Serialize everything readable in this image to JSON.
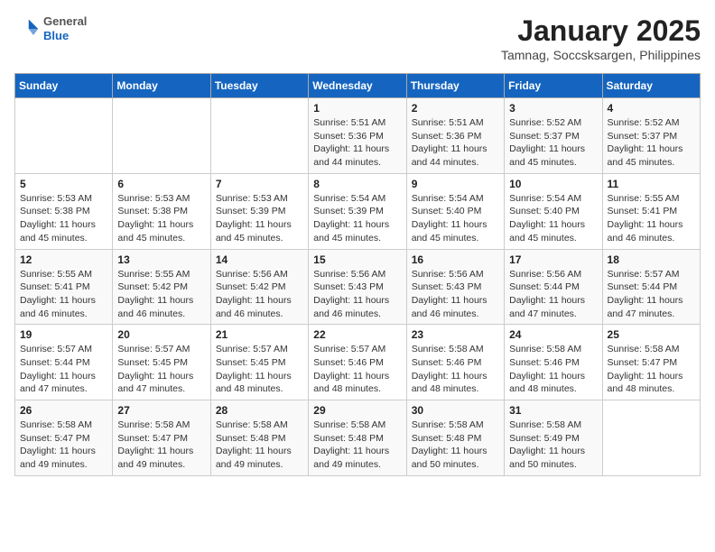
{
  "logo": {
    "general": "General",
    "blue": "Blue"
  },
  "header": {
    "month": "January 2025",
    "location": "Tamnag, Soccsksargen, Philippines"
  },
  "days_of_week": [
    "Sunday",
    "Monday",
    "Tuesday",
    "Wednesday",
    "Thursday",
    "Friday",
    "Saturday"
  ],
  "weeks": [
    [
      {
        "day": "",
        "sunrise": "",
        "sunset": "",
        "daylight": ""
      },
      {
        "day": "",
        "sunrise": "",
        "sunset": "",
        "daylight": ""
      },
      {
        "day": "",
        "sunrise": "",
        "sunset": "",
        "daylight": ""
      },
      {
        "day": "1",
        "sunrise": "Sunrise: 5:51 AM",
        "sunset": "Sunset: 5:36 PM",
        "daylight": "Daylight: 11 hours and 44 minutes."
      },
      {
        "day": "2",
        "sunrise": "Sunrise: 5:51 AM",
        "sunset": "Sunset: 5:36 PM",
        "daylight": "Daylight: 11 hours and 44 minutes."
      },
      {
        "day": "3",
        "sunrise": "Sunrise: 5:52 AM",
        "sunset": "Sunset: 5:37 PM",
        "daylight": "Daylight: 11 hours and 45 minutes."
      },
      {
        "day": "4",
        "sunrise": "Sunrise: 5:52 AM",
        "sunset": "Sunset: 5:37 PM",
        "daylight": "Daylight: 11 hours and 45 minutes."
      }
    ],
    [
      {
        "day": "5",
        "sunrise": "Sunrise: 5:53 AM",
        "sunset": "Sunset: 5:38 PM",
        "daylight": "Daylight: 11 hours and 45 minutes."
      },
      {
        "day": "6",
        "sunrise": "Sunrise: 5:53 AM",
        "sunset": "Sunset: 5:38 PM",
        "daylight": "Daylight: 11 hours and 45 minutes."
      },
      {
        "day": "7",
        "sunrise": "Sunrise: 5:53 AM",
        "sunset": "Sunset: 5:39 PM",
        "daylight": "Daylight: 11 hours and 45 minutes."
      },
      {
        "day": "8",
        "sunrise": "Sunrise: 5:54 AM",
        "sunset": "Sunset: 5:39 PM",
        "daylight": "Daylight: 11 hours and 45 minutes."
      },
      {
        "day": "9",
        "sunrise": "Sunrise: 5:54 AM",
        "sunset": "Sunset: 5:40 PM",
        "daylight": "Daylight: 11 hours and 45 minutes."
      },
      {
        "day": "10",
        "sunrise": "Sunrise: 5:54 AM",
        "sunset": "Sunset: 5:40 PM",
        "daylight": "Daylight: 11 hours and 45 minutes."
      },
      {
        "day": "11",
        "sunrise": "Sunrise: 5:55 AM",
        "sunset": "Sunset: 5:41 PM",
        "daylight": "Daylight: 11 hours and 46 minutes."
      }
    ],
    [
      {
        "day": "12",
        "sunrise": "Sunrise: 5:55 AM",
        "sunset": "Sunset: 5:41 PM",
        "daylight": "Daylight: 11 hours and 46 minutes."
      },
      {
        "day": "13",
        "sunrise": "Sunrise: 5:55 AM",
        "sunset": "Sunset: 5:42 PM",
        "daylight": "Daylight: 11 hours and 46 minutes."
      },
      {
        "day": "14",
        "sunrise": "Sunrise: 5:56 AM",
        "sunset": "Sunset: 5:42 PM",
        "daylight": "Daylight: 11 hours and 46 minutes."
      },
      {
        "day": "15",
        "sunrise": "Sunrise: 5:56 AM",
        "sunset": "Sunset: 5:43 PM",
        "daylight": "Daylight: 11 hours and 46 minutes."
      },
      {
        "day": "16",
        "sunrise": "Sunrise: 5:56 AM",
        "sunset": "Sunset: 5:43 PM",
        "daylight": "Daylight: 11 hours and 46 minutes."
      },
      {
        "day": "17",
        "sunrise": "Sunrise: 5:56 AM",
        "sunset": "Sunset: 5:44 PM",
        "daylight": "Daylight: 11 hours and 47 minutes."
      },
      {
        "day": "18",
        "sunrise": "Sunrise: 5:57 AM",
        "sunset": "Sunset: 5:44 PM",
        "daylight": "Daylight: 11 hours and 47 minutes."
      }
    ],
    [
      {
        "day": "19",
        "sunrise": "Sunrise: 5:57 AM",
        "sunset": "Sunset: 5:44 PM",
        "daylight": "Daylight: 11 hours and 47 minutes."
      },
      {
        "day": "20",
        "sunrise": "Sunrise: 5:57 AM",
        "sunset": "Sunset: 5:45 PM",
        "daylight": "Daylight: 11 hours and 47 minutes."
      },
      {
        "day": "21",
        "sunrise": "Sunrise: 5:57 AM",
        "sunset": "Sunset: 5:45 PM",
        "daylight": "Daylight: 11 hours and 48 minutes."
      },
      {
        "day": "22",
        "sunrise": "Sunrise: 5:57 AM",
        "sunset": "Sunset: 5:46 PM",
        "daylight": "Daylight: 11 hours and 48 minutes."
      },
      {
        "day": "23",
        "sunrise": "Sunrise: 5:58 AM",
        "sunset": "Sunset: 5:46 PM",
        "daylight": "Daylight: 11 hours and 48 minutes."
      },
      {
        "day": "24",
        "sunrise": "Sunrise: 5:58 AM",
        "sunset": "Sunset: 5:46 PM",
        "daylight": "Daylight: 11 hours and 48 minutes."
      },
      {
        "day": "25",
        "sunrise": "Sunrise: 5:58 AM",
        "sunset": "Sunset: 5:47 PM",
        "daylight": "Daylight: 11 hours and 48 minutes."
      }
    ],
    [
      {
        "day": "26",
        "sunrise": "Sunrise: 5:58 AM",
        "sunset": "Sunset: 5:47 PM",
        "daylight": "Daylight: 11 hours and 49 minutes."
      },
      {
        "day": "27",
        "sunrise": "Sunrise: 5:58 AM",
        "sunset": "Sunset: 5:47 PM",
        "daylight": "Daylight: 11 hours and 49 minutes."
      },
      {
        "day": "28",
        "sunrise": "Sunrise: 5:58 AM",
        "sunset": "Sunset: 5:48 PM",
        "daylight": "Daylight: 11 hours and 49 minutes."
      },
      {
        "day": "29",
        "sunrise": "Sunrise: 5:58 AM",
        "sunset": "Sunset: 5:48 PM",
        "daylight": "Daylight: 11 hours and 49 minutes."
      },
      {
        "day": "30",
        "sunrise": "Sunrise: 5:58 AM",
        "sunset": "Sunset: 5:48 PM",
        "daylight": "Daylight: 11 hours and 50 minutes."
      },
      {
        "day": "31",
        "sunrise": "Sunrise: 5:58 AM",
        "sunset": "Sunset: 5:49 PM",
        "daylight": "Daylight: 11 hours and 50 minutes."
      },
      {
        "day": "",
        "sunrise": "",
        "sunset": "",
        "daylight": ""
      }
    ]
  ]
}
